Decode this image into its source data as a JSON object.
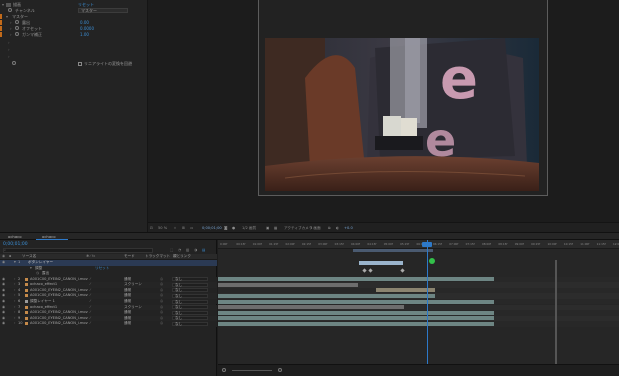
{
  "effects": {
    "rows": [
      {
        "label": "描画",
        "value": "リセット",
        "value2": ""
      },
      {
        "label": "チャンネル",
        "value": "マスター",
        "value2": ""
      },
      {
        "label": "マスター",
        "value": "",
        "value2": ""
      },
      {
        "label": "露出",
        "value": "0.00",
        "value2": ""
      },
      {
        "label": "オフセット",
        "value": "0.0000",
        "value2": ""
      },
      {
        "label": "ガンマ補正",
        "value": "1.00",
        "value2": ""
      }
    ],
    "checkbox_label": "リニアライトの変換を回避"
  },
  "viewer": {
    "zoom": "50 %",
    "timecode": "0;00;01;00",
    "resolution": "1/2 画質",
    "camera": "アクティブカメラ",
    "views": "1 画面",
    "exposure": "+0.0"
  },
  "timeline": {
    "tabs": [
      "ochaco",
      "ochaco"
    ],
    "timecode": "0;00;01;00",
    "search_placeholder": "",
    "col_source": "ソース名",
    "col_mode": "モード",
    "col_trkmat": "トラックマット",
    "col_parent": "親とリンク",
    "ruler_ticks": [
      "0:00f",
      "00:15f",
      "01:00f",
      "01:15f",
      "02:00f",
      "02:15f",
      "03:00f",
      "03:15f",
      "04:00f",
      "04:15f",
      "05:00f",
      "05:15f",
      "06:00f",
      "06:15f",
      "07:00f",
      "07:15f",
      "08:00f",
      "08:15f",
      "09:00f",
      "09:15f",
      "10:00f",
      "10:15f",
      "11:00f",
      "11:15f",
      "12:00f"
    ],
    "sublayer_a": "調整",
    "sublayer_b": "露出",
    "sublayer_b_value": "リセット",
    "layers": [
      {
        "num": "1",
        "name": "ボタンレイヤー",
        "mode": "",
        "parent": ""
      },
      {
        "num": "2",
        "name": "A001C00_EYEIN2_CANON_i.mov",
        "mode": "通常",
        "parent": "なし"
      },
      {
        "num": "3",
        "name": "ochaco_effect1",
        "mode": "スクリーン",
        "parent": "なし"
      },
      {
        "num": "4",
        "name": "A001C00_EYEIN2_CANON_i.mov",
        "mode": "通常",
        "parent": "なし"
      },
      {
        "num": "5",
        "name": "A001C00_EYEIN2_CANON_i.mov",
        "mode": "通常",
        "parent": "なし"
      },
      {
        "num": "6",
        "name": "調整レイヤー 1",
        "mode": "通常",
        "parent": "なし"
      },
      {
        "num": "7",
        "name": "ochaco_effect1",
        "mode": "スクリーン",
        "parent": "なし"
      },
      {
        "num": "8",
        "name": "A001C00_EYEIN2_CANON_i.mov",
        "mode": "通常",
        "parent": "なし"
      },
      {
        "num": "9",
        "name": "A001C00_EYEIN2_CANON_i.mov",
        "mode": "通常",
        "parent": "なし"
      },
      {
        "num": "10",
        "name": "A001C00_EYEIN2_CANON_i.mov",
        "mode": "通常",
        "parent": "なし"
      }
    ]
  }
}
